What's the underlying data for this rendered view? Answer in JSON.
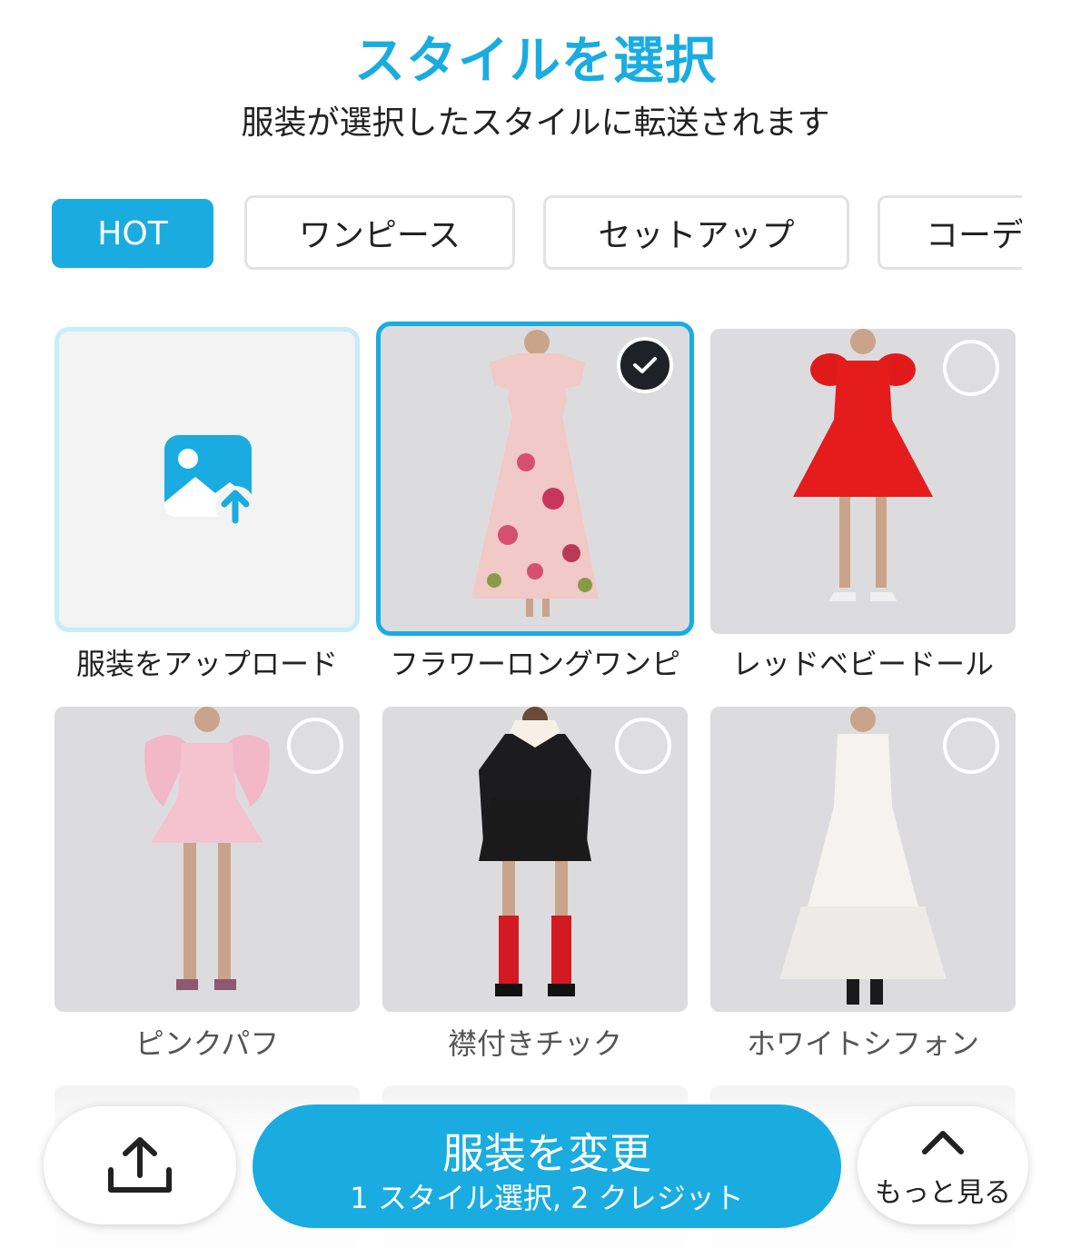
{
  "header": {
    "title": "スタイルを選択",
    "subtitle": "服装が選択したスタイルに転送されます"
  },
  "tabs": [
    {
      "label": "HOT",
      "active": true
    },
    {
      "label": "ワンピース",
      "active": false
    },
    {
      "label": "セットアップ",
      "active": false
    },
    {
      "label": "コーデ",
      "active": false
    }
  ],
  "styles": [
    {
      "label": "服装をアップロード",
      "type": "upload"
    },
    {
      "label": "フラワーロングワンピ",
      "selected": true
    },
    {
      "label": "レッドベビードール",
      "selected": false
    },
    {
      "label": "ピンクパフ",
      "selected": false
    },
    {
      "label": "襟付きチック",
      "selected": false
    },
    {
      "label": "ホワイトシフォン",
      "selected": false
    }
  ],
  "colors": {
    "accent": "#1aace0",
    "tab_border": "#e2e2e2",
    "upload_border": "#c8ecf8"
  },
  "bottom": {
    "share_icon": "share-icon",
    "main_label": "服装を変更",
    "main_sub": "1 スタイル選択, 2 クレジット",
    "more_label": "もっと見る",
    "more_icon": "chevron-up-icon"
  }
}
